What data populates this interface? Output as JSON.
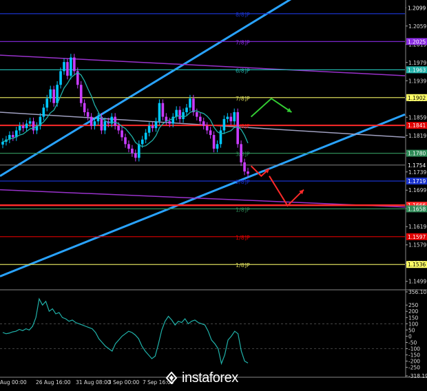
{
  "chart_data": [
    {
      "type": "line",
      "panel": "price",
      "y_ticks": [
        "1.2099",
        "1.2059",
        "1.2019",
        "1.1979",
        "1.1939",
        "1.1899",
        "1.1859",
        "1.1819",
        "1.1779",
        "1.1739",
        "1.1699",
        "1.1659",
        "1.1619",
        "1.1579",
        "1.1539",
        "1.1499"
      ],
      "ylim": [
        1.1485,
        1.211
      ],
      "price_tags": [
        {
          "text": "1.2099",
          "bg": "#000000",
          "fg": "#ffffff",
          "value": 1.2099
        },
        {
          "text": "1.2025",
          "bg": "#8a2be2",
          "fg": "#ffffff",
          "value": 1.2025
        },
        {
          "text": "1.1963",
          "bg": "#20b2aa",
          "fg": "#ffffff",
          "value": 1.1963
        },
        {
          "text": "1.1902",
          "bg": "#ffff66",
          "fg": "#000000",
          "value": 1.1902
        },
        {
          "text": "1.1841",
          "bg": "#e00000",
          "fg": "#ffffff",
          "value": 1.1841
        },
        {
          "text": "1.1780",
          "bg": "#2e8b57",
          "fg": "#ffffff",
          "value": 1.178
        },
        {
          "text": "1.1754",
          "bg": "#000000",
          "fg": "#ffffff",
          "value": 1.1754
        },
        {
          "text": "1.1719",
          "bg": "#1a33cc",
          "fg": "#ffffff",
          "value": 1.1719
        },
        {
          "text": "1.1666",
          "bg": "#ff2a2a",
          "fg": "#ffffff",
          "value": 1.1666
        },
        {
          "text": "1.1658",
          "bg": "#2e8b57",
          "fg": "#ffffff",
          "value": 1.1658
        },
        {
          "text": "1.1597",
          "bg": "#e00000",
          "fg": "#ffffff",
          "value": 1.1597
        },
        {
          "text": "1.1536",
          "bg": "#ffff66",
          "fg": "#000000",
          "value": 1.1536
        }
      ],
      "murray_levels": [
        {
          "label": "8/8]P",
          "value": 1.2086,
          "color": "#1a33cc"
        },
        {
          "label": "7/8]P",
          "value": 1.2025,
          "color": "#8a2be2"
        },
        {
          "label": "6/8]P",
          "value": 1.1963,
          "color": "#20b2aa"
        },
        {
          "label": "7/8]P",
          "value": 1.1902,
          "color": "#d8d85a"
        },
        {
          "label": "4/8]P",
          "value": 1.1841,
          "color": "#e00000"
        },
        {
          "label": "3/8]P",
          "value": 1.178,
          "color": "#2e8b57"
        },
        {
          "label": "2/8]P",
          "value": 1.1719,
          "color": "#1a33cc"
        },
        {
          "label": "1/8]P",
          "value": 1.1658,
          "color": "#2e8b57"
        },
        {
          "label": "1/8]P",
          "value": 1.1597,
          "color": "#e00000"
        },
        {
          "label": "1/8]P",
          "value": 1.1536,
          "color": "#d8d85a"
        }
      ],
      "level_red": 1.1666,
      "level_gray": 1.1754,
      "trend_lines": [
        {
          "name": "upper-channel",
          "color": "#29a3ff",
          "from": [
            0,
            1.173
          ],
          "to": [
            1,
            1.227
          ]
        },
        {
          "name": "lower-channel",
          "color": "#29a3ff",
          "from": [
            0,
            1.151
          ],
          "to": [
            1,
            1.1865
          ]
        },
        {
          "name": "violet-upper",
          "color": "#9932cc",
          "from": [
            0,
            1.1995
          ],
          "to": [
            1,
            1.195
          ]
        },
        {
          "name": "violet-lower",
          "color": "#9932cc",
          "from": [
            0,
            1.17
          ],
          "to": [
            1,
            1.1662
          ]
        },
        {
          "name": "gray-mid",
          "color": "#a0a0c0",
          "from": [
            0,
            1.187
          ],
          "to": [
            1,
            1.1815
          ]
        }
      ],
      "close_series": [
        1.1805,
        1.181,
        1.182,
        1.1815,
        1.183,
        1.184,
        1.1835,
        1.1845,
        1.185,
        1.183,
        1.184,
        1.186,
        1.188,
        1.19,
        1.192,
        1.189,
        1.193,
        1.196,
        1.198,
        1.195,
        1.199,
        1.196,
        1.193,
        1.189,
        1.187,
        1.186,
        1.184,
        1.185,
        1.186,
        1.183,
        1.185,
        1.1845,
        1.186,
        1.184,
        1.183,
        1.1815,
        1.18,
        1.179,
        1.178,
        1.177,
        1.18,
        1.181,
        1.1825,
        1.184,
        1.1835,
        1.185,
        1.189,
        1.186,
        1.185,
        1.1845,
        1.186,
        1.1875,
        1.1855,
        1.187,
        1.188,
        1.19,
        1.187,
        1.186,
        1.185,
        1.184,
        1.183,
        1.182,
        1.179,
        1.18,
        1.183,
        1.1855,
        1.186,
        1.185,
        1.187,
        1.18,
        1.176,
        1.174,
        1.1735
      ],
      "x_labels": [
        "Aug 00:00",
        "26 Aug 16:00",
        "31 Aug 08:00",
        "3 Sep 00:00",
        "7 Sep 16:00",
        "",
        "",
        "",
        "",
        "",
        "",
        "",
        "",
        "",
        ""
      ],
      "annotation_arrows": [
        {
          "color": "#33cc33",
          "points": [
            [
              0.62,
              1.186
            ],
            [
              0.67,
              1.19
            ],
            [
              0.72,
              1.187
            ]
          ]
        },
        {
          "color": "#ff2a2a",
          "points": [
            [
              0.62,
              1.1752
            ],
            [
              0.645,
              1.173
            ],
            [
              0.665,
              1.1746
            ]
          ]
        },
        {
          "color": "#ff2a2a",
          "points": [
            [
              0.665,
              1.173
            ],
            [
              0.71,
              1.1665
            ],
            [
              0.75,
              1.17
            ]
          ]
        }
      ]
    },
    {
      "type": "line",
      "panel": "cci",
      "y_ticks": [
        "356.1054",
        "250",
        "200",
        "150",
        "100",
        "50",
        "0",
        "-50",
        "-100",
        "-150",
        "-200",
        "-250",
        "-318.199"
      ],
      "ylim": [
        -318.199,
        356.1054
      ],
      "values": [
        30,
        20,
        25,
        35,
        40,
        55,
        45,
        60,
        50,
        80,
        150,
        300,
        250,
        280,
        200,
        220,
        180,
        190,
        150,
        140,
        120,
        130,
        110,
        100,
        90,
        80,
        70,
        60,
        30,
        -20,
        -50,
        -80,
        -100,
        -120,
        -60,
        -30,
        0,
        20,
        40,
        30,
        10,
        -20,
        -80,
        -120,
        -150,
        -180,
        -160,
        -60,
        50,
        120,
        160,
        130,
        90,
        120,
        110,
        140,
        100,
        120,
        130,
        110,
        100,
        90,
        40,
        -30,
        -60,
        -100,
        -220,
        -150,
        -30,
        0,
        40,
        20,
        -120,
        -200,
        -215
      ]
    }
  ],
  "brand": {
    "name": "instaforex"
  },
  "colors": {
    "background": "#000000",
    "bull": "#00c8ff",
    "bear": "#c83cff",
    "ma": "#20b2aa",
    "cci_line": "#20b2aa"
  }
}
